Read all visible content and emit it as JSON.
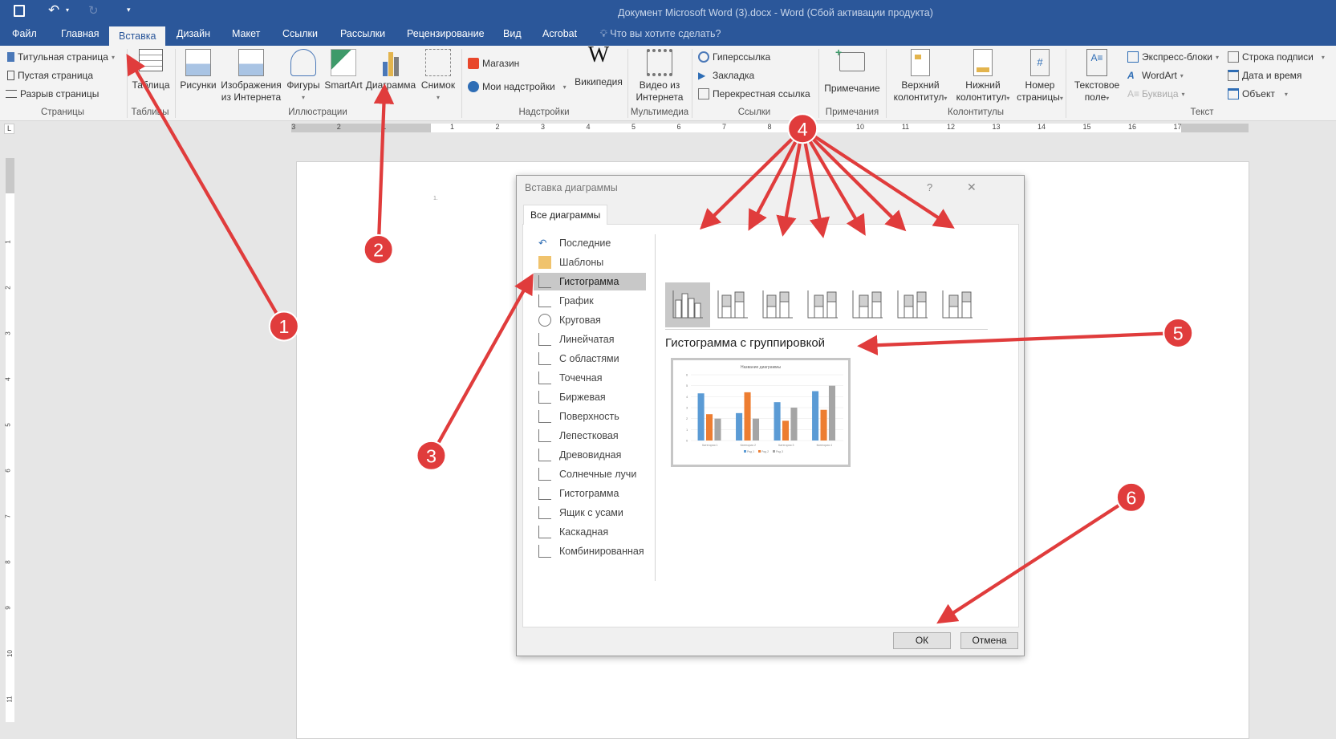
{
  "titlebar": {
    "title": "Документ Microsoft Word (3).docx - Word (Сбой активации продукта)"
  },
  "tabs": [
    "Файл",
    "Главная",
    "Вставка",
    "Дизайн",
    "Макет",
    "Ссылки",
    "Рассылки",
    "Рецензирование",
    "Вид",
    "Acrobat"
  ],
  "tell_me": "Что вы хотите сделать?",
  "ribbon": {
    "pages": {
      "label": "Страницы",
      "items": [
        "Титульная страница",
        "Пустая страница",
        "Разрыв страницы"
      ]
    },
    "tables": {
      "label": "Таблицы",
      "table": "Таблица"
    },
    "illustrations": {
      "label": "Иллюстрации",
      "pictures": "Рисунки",
      "online1": "Изображения",
      "online2": "из Интернета",
      "shapes": "Фигуры",
      "smartart": "SmartArt",
      "chart": "Диаграмма",
      "screenshot": "Снимок"
    },
    "addins": {
      "label": "Надстройки",
      "store": "Магазин",
      "my": "Мои надстройки",
      "wiki": "Википедия"
    },
    "media": {
      "label": "Мультимедиа",
      "video1": "Видео из",
      "video2": "Интернета"
    },
    "links": {
      "label": "Ссылки",
      "items": [
        "Гиперссылка",
        "Закладка",
        "Перекрестная ссылка"
      ]
    },
    "comments": {
      "label": "Примечания",
      "comment": "Примечание"
    },
    "headers": {
      "label": "Колонтитулы",
      "header1": "Верхний",
      "header2": "колонтитул",
      "footer1": "Нижний",
      "footer2": "колонтитул",
      "pagenum1": "Номер",
      "pagenum2": "страницы"
    },
    "text": {
      "label": "Текст",
      "textbox1": "Текстовое",
      "textbox2": "поле",
      "quickparts": "Экспресс-блоки",
      "wordart": "WordArt",
      "dropcap": "Буквица",
      "sigline": "Строка подписи",
      "datetime": "Дата и время",
      "object": "Объект"
    }
  },
  "ruler": {
    "labels": [
      "3",
      "2",
      "1",
      "1",
      "2",
      "3",
      "4",
      "5",
      "6",
      "7",
      "8",
      "9",
      "10",
      "11",
      "12",
      "13",
      "14",
      "15",
      "16",
      "17"
    ]
  },
  "vruler": {
    "labels": [
      "1",
      "2",
      "3",
      "4",
      "5",
      "6",
      "7",
      "8",
      "9",
      "10",
      "11"
    ]
  },
  "page": {
    "paragraph_mark": "1."
  },
  "dialog": {
    "title": "Вставка диаграммы",
    "help": "?",
    "close": "✕",
    "tab": "Все диаграммы",
    "categories": [
      "Последние",
      "Шаблоны",
      "Гистограмма",
      "График",
      "Круговая",
      "Линейчатая",
      "С областями",
      "Точечная",
      "Биржевая",
      "Поверхность",
      "Лепестковая",
      "Древовидная",
      "Солнечные лучи",
      "Гистограмма",
      "Ящик с усами",
      "Каскадная",
      "Комбинированная"
    ],
    "selected_category": "Гистограмма",
    "subtype_title": "Гистограмма с группировкой",
    "ok": "ОК",
    "cancel": "Отмена"
  },
  "chart_data": {
    "type": "bar",
    "title": "Название диаграммы",
    "categories": [
      "Категория 1",
      "Категория 2",
      "Категория 3",
      "Категория 4"
    ],
    "series": [
      {
        "name": "Ряд 1",
        "values": [
          4.3,
          2.5,
          3.5,
          4.5
        ],
        "color": "#5b9bd5"
      },
      {
        "name": "Ряд 2",
        "values": [
          2.4,
          4.4,
          1.8,
          2.8
        ],
        "color": "#ed7d31"
      },
      {
        "name": "Ряд 3",
        "values": [
          2,
          2,
          3,
          5
        ],
        "color": "#a5a5a5"
      }
    ],
    "ylim": [
      0,
      6
    ],
    "yticks": [
      "0",
      "1",
      "2",
      "3",
      "4",
      "5",
      "6"
    ],
    "grid": true,
    "legend": "bottom"
  },
  "annotations": [
    "1",
    "2",
    "3",
    "4",
    "5",
    "6"
  ],
  "colors": {
    "accent": "#2b579a",
    "arrow": "#e03c3c"
  }
}
